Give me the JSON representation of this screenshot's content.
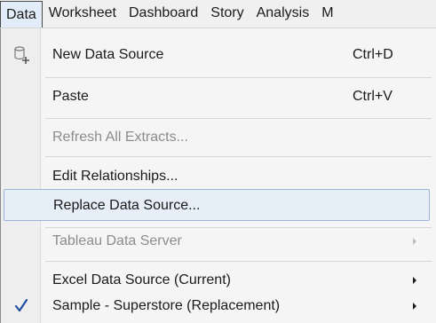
{
  "menubar": {
    "items": [
      "Data",
      "Worksheet",
      "Dashboard",
      "Story",
      "Analysis",
      "M"
    ]
  },
  "menu": {
    "new_data_source": {
      "label": "New Data Source",
      "shortcut": "Ctrl+D",
      "icon": "new-data-source-icon"
    },
    "paste": {
      "label": "Paste",
      "shortcut": "Ctrl+V"
    },
    "refresh_extracts": {
      "label": "Refresh All Extracts..."
    },
    "edit_relationships": {
      "label": "Edit Relationships..."
    },
    "replace_data_source": {
      "label": "Replace Data Source..."
    },
    "tableau_data_server": {
      "label": "Tableau Data Server"
    },
    "excel_data_source": {
      "label": "Excel Data Source (Current)"
    },
    "sample_superstore": {
      "label": "Sample - Superstore (Replacement)",
      "checked": true,
      "icon": "checkmark-icon"
    }
  },
  "colors": {
    "highlight": "#e6eef8",
    "checkmark": "#1f4fa0",
    "disabled_text": "#8c8c8c"
  }
}
